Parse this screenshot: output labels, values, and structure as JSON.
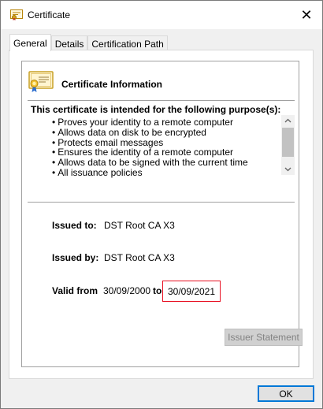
{
  "window": {
    "title": "Certificate",
    "title_icon": "certificate-icon",
    "close_glyph": "✕"
  },
  "tabs": [
    {
      "label": "General",
      "active": true
    },
    {
      "label": "Details",
      "active": false
    },
    {
      "label": "Certification Path",
      "active": false
    }
  ],
  "general": {
    "info_title": "Certificate Information",
    "purpose_heading": "This certificate is intended for the following purpose(s):",
    "purposes": [
      "Proves your identity to a remote computer",
      "Allows data on disk to be encrypted",
      "Protects email messages",
      "Ensures the identity of a remote computer",
      "Allows data to be signed with the current time",
      "All issuance policies"
    ],
    "issued_to_label": "Issued to:",
    "issued_to_value": "DST Root CA X3",
    "issued_by_label": "Issued by:",
    "issued_by_value": "DST Root CA X3",
    "valid_from_label": "Valid from",
    "valid_from_value": "30/09/2000",
    "to_label": "to",
    "valid_to_value": "30/09/2021",
    "issuer_statement_label": "Issuer Statement"
  },
  "footer": {
    "ok_label": "OK"
  },
  "colors": {
    "highlight_border": "#e81123",
    "default_button_border": "#0078d7"
  }
}
